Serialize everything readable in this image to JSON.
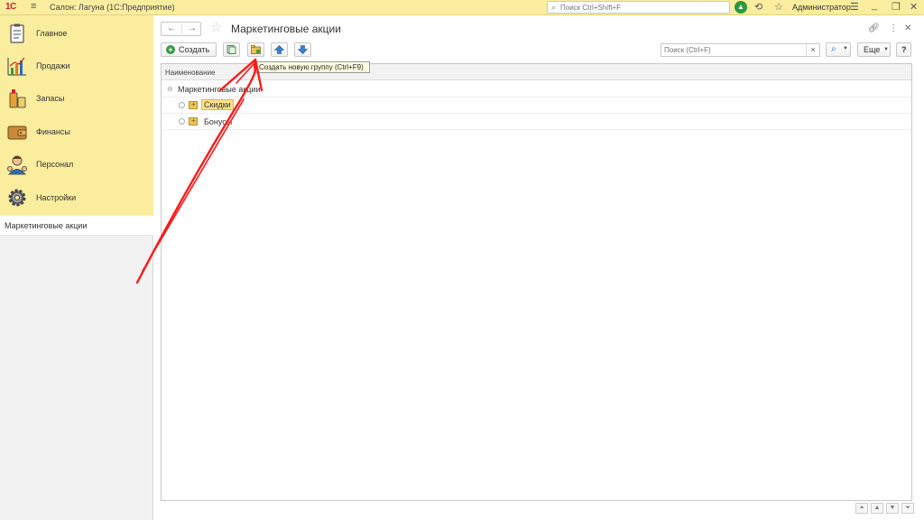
{
  "topbar": {
    "logo": "1С",
    "app_title": "Салон: Лагуна  (1С:Предприятие)",
    "search_placeholder": "Поиск Ctrl+Shift+F",
    "user": "Администратор"
  },
  "sidebar": {
    "items": [
      {
        "label": "Главное",
        "icon": "clipboard-icon"
      },
      {
        "label": "Продажи",
        "icon": "sales-chart-icon"
      },
      {
        "label": "Запасы",
        "icon": "stock-icon"
      },
      {
        "label": "Финансы",
        "icon": "wallet-icon"
      },
      {
        "label": "Персонал",
        "icon": "staff-icon"
      },
      {
        "label": "Настройки",
        "icon": "gear-icon"
      }
    ],
    "open_window": "Маркетинговые акции"
  },
  "main": {
    "title": "Маркетинговые акции",
    "toolbar": {
      "create_label": "Создать",
      "search_placeholder": "Поиск (Ctrl+F)",
      "clear": "×",
      "more_label": "Еще",
      "help_label": "?"
    },
    "tooltip": "Создать новую группу (Ctrl+F9)",
    "table": {
      "column": "Наименование",
      "root": "Маркетинговые акции",
      "rows": [
        {
          "label": "Скидки",
          "selected": true
        },
        {
          "label": "Бонусы",
          "selected": false
        }
      ]
    }
  },
  "colors": {
    "header_yellow": "#fbed9e",
    "annotation_arrow": "#ff1a1a",
    "create_green": "#3a9a44"
  }
}
